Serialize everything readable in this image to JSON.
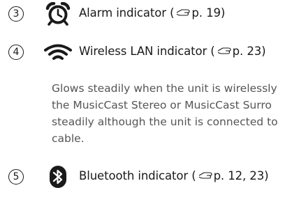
{
  "colors": {
    "text": "#1a1a1a",
    "desc_text": "#555555"
  },
  "items": [
    {
      "number": "3",
      "icon": "alarm-clock-icon",
      "label": "Alarm indicator (",
      "page_ref": "p. 19)"
    },
    {
      "number": "4",
      "icon": "wifi-icon",
      "label": "Wireless LAN indicator (",
      "page_ref": "p. 23)",
      "description_lines": [
        "Glows steadily when the unit is wirelessly",
        "the MusicCast Stereo or MusicCast Surro",
        "steadily although the unit is connected to",
        "cable."
      ]
    },
    {
      "number": "5",
      "icon": "bluetooth-icon",
      "label": "Bluetooth indicator (",
      "page_ref": "p. 12, 23)"
    }
  ],
  "page_ref_icon": "pointing-hand-icon"
}
